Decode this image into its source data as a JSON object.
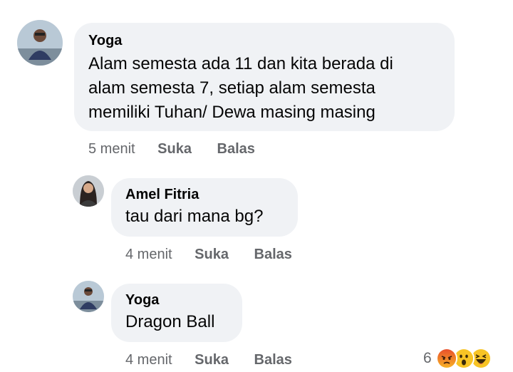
{
  "comments": [
    {
      "author": "Yoga",
      "text_lines": [
        "Alam semesta ada 11 dan kita berada di",
        "alam semesta 7, setiap alam semesta",
        "memiliki Tuhan/ Dewa masing masing"
      ],
      "time": "5 menit",
      "like_label": "Suka",
      "reply_label": "Balas"
    },
    {
      "author": "Amel Fitria",
      "text_lines": [
        "tau dari mana bg?"
      ],
      "time": "4 menit",
      "like_label": "Suka",
      "reply_label": "Balas"
    },
    {
      "author": "Yoga",
      "text_lines": [
        "Dragon Ball"
      ],
      "time": "4 menit",
      "like_label": "Suka",
      "reply_label": "Balas"
    }
  ],
  "reactions": {
    "count": "6",
    "icons": [
      "angry-icon",
      "wow-icon",
      "haha-icon"
    ]
  }
}
